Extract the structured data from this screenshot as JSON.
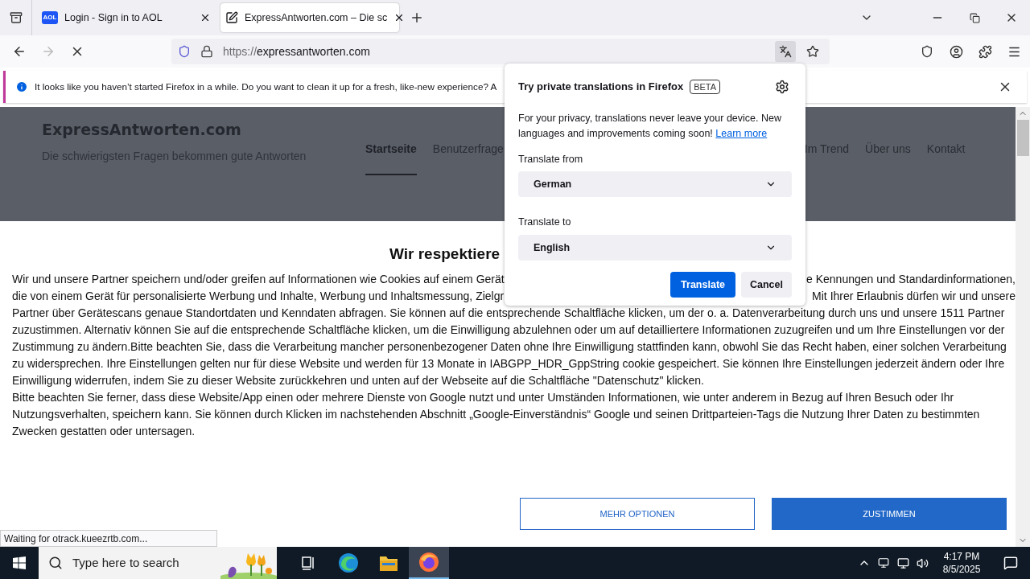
{
  "tabs": [
    {
      "kind": "badge",
      "favicon": "AOL",
      "title": "Login - Sign in to AOL",
      "selected": false
    },
    {
      "kind": "edit",
      "title": "ExpressAntworten.com – Die sc",
      "selected": true
    }
  ],
  "address": {
    "scheme": "https://",
    "host": "expressantworten.com"
  },
  "notification": {
    "message": "It looks like you haven’t started Firefox in a while. Do you want to clean it up for a fresh, like-new experience? A"
  },
  "translation_popup": {
    "title": "Try private translations in Firefox",
    "badge": "BETA",
    "description": "For your privacy, translations never leave your device. New languages and improvements coming soon!",
    "link": "Learn more",
    "from_label": "Translate from",
    "from_value": "German",
    "to_label": "Translate to",
    "to_value": "English",
    "primary": "Translate",
    "secondary": "Cancel"
  },
  "site": {
    "title": "ExpressAntworten.com",
    "tagline": "Die schwierigsten Fragen bekommen gute Antworten",
    "nav_left": [
      {
        "label": "Startseite",
        "selected": true
      },
      {
        "label": "Benutzerfrage",
        "selected": false
      }
    ],
    "nav_right": [
      {
        "label": "Im Trend",
        "selected": false
      },
      {
        "label": "Über uns",
        "selected": false
      },
      {
        "label": "Kontakt",
        "selected": false
      }
    ]
  },
  "consent": {
    "heading": "Wir respektiere",
    "lines": [
      {
        "kind": "split",
        "left": "Wir und unsere Partner speichern und/oder greifen auf Informationen wie Cookies auf einem Gerät",
        "right": "e Kennungen und Standardinformationen,"
      },
      {
        "kind": "split",
        "left": "die von einem Gerät für personalisierte Werbung und Inhalte, Werbung und Inhaltsmessung, Zielgr",
        "right": "Mit Ihrer Erlaubnis dürfen wir und unsere"
      },
      {
        "kind": "full",
        "text": "Partner über Gerätescans genaue Standortdaten und Kenndaten abfragen. Sie können auf die entsprechende Schaltfläche klicken, um der o. a. Datenverarbeitung durch uns und unsere 1511 Partner"
      },
      {
        "kind": "full",
        "text": "zuzustimmen. Alternativ können Sie auf die entsprechende Schaltfläche klicken, um die Einwilligung abzulehnen oder um auf detailliertere Informationen zuzugreifen und um Ihre Einstellungen vor der"
      },
      {
        "kind": "full",
        "text": "Zustimmung zu ändern.Bitte beachten Sie, dass die Verarbeitung mancher personenbezogener Daten ohne Ihre Einwilligung stattfinden kann, obwohl Sie das Recht haben, einer solchen Verarbeitung"
      },
      {
        "kind": "full",
        "text": "zu widersprechen. Ihre Einstellungen gelten nur für diese Website und werden für 13 Monate in IABGPP_HDR_GppString cookie gespeichert. Sie können Ihre Einstellungen jederzeit ändern oder Ihre"
      },
      {
        "kind": "full",
        "text": "Einwilligung widerrufen, indem Sie zu dieser Website zurückkehren und unten auf der Webseite auf die Schaltfläche \"Datenschutz\" klicken."
      },
      {
        "kind": "full",
        "text": "Bitte beachten Sie ferner, dass diese Website/App einen oder mehrere Dienste von Google nutzt und unter Umständen Informationen, wie unter anderem in Bezug auf Ihren Besuch oder Ihr"
      },
      {
        "kind": "full",
        "text": "Nutzungsverhalten, speichern kann. Sie können durch Klicken im nachstehenden Abschnitt „Google-Einverständnis“ Google und seinen Drittparteien-Tags die Nutzung Ihrer Daten zu bestimmten"
      },
      {
        "kind": "full",
        "text": "Zwecken gestatten oder untersagen."
      }
    ],
    "more_button": "MEHR OPTIONEN",
    "accept_button": "ZUSTIMMEN"
  },
  "status": "Waiting for otrack.kueezrtb.com...",
  "taskbar": {
    "search_placeholder": "Type here to search",
    "apps": [
      {
        "kind": "task-view",
        "selected": false
      },
      {
        "kind": "edge",
        "selected": false
      },
      {
        "kind": "explorer",
        "selected": false
      },
      {
        "kind": "firefox",
        "selected": true
      }
    ],
    "time": "4:17 PM",
    "date": "8/5/2025"
  }
}
